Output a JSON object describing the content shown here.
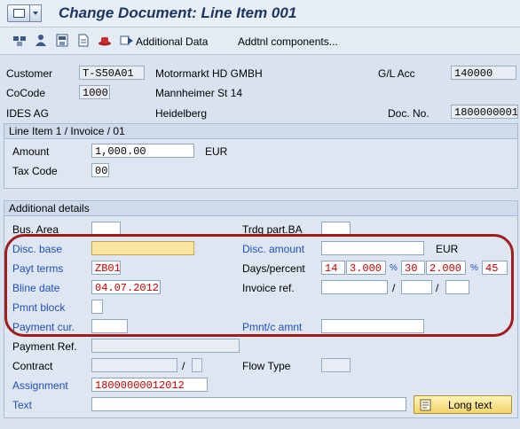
{
  "window": {
    "title": "Change Document: Line Item 001"
  },
  "toolbar": {
    "additional_data": "Additional Data",
    "addtnl_components": "Addtnl components..."
  },
  "header": {
    "customer_label": "Customer",
    "customer_value": "T-S50A01",
    "customer_name": "Motormarkt HD GMBH",
    "gl_acc_label": "G/L Acc",
    "gl_acc_value": "140000",
    "cocode_label": "CoCode",
    "cocode_value": "1000",
    "street": "Mannheimer St 14",
    "company": "IDES AG",
    "city": "Heidelberg",
    "doc_no_label": "Doc. No.",
    "doc_no_value": "1800000001"
  },
  "line_item": {
    "section_title": "Line Item 1 / Invoice / 01",
    "amount_label": "Amount",
    "amount_value": "1,000.00",
    "currency": "EUR",
    "tax_code_label": "Tax Code",
    "tax_code_value": "00"
  },
  "additional": {
    "section_title": "Additional details",
    "bus_area_label": "Bus. Area",
    "bus_area_value": "",
    "trdg_label": "Trdg part.BA",
    "trdg_value": "",
    "disc_base_label": "Disc. base",
    "disc_base_value": "",
    "disc_amount_label": "Disc. amount",
    "disc_amount_value": "",
    "disc_currency": "EUR",
    "payt_terms_label": "Payt terms",
    "payt_terms_value": "ZB01",
    "days_percent_label": "Days/percent",
    "days1": "14",
    "pct1": "3.000",
    "days2": "30",
    "pct2": "2.000",
    "days3": "45",
    "percent_sign": "%",
    "bline_label": "Bline date",
    "bline_value": "04.07.2012",
    "invoice_ref_label": "Invoice ref.",
    "slash": "/",
    "pmnt_block_label": "Pmnt block",
    "payment_cur_label": "Payment cur.",
    "pmnt_c_amnt_label": "Pmnt/c amnt",
    "payment_ref_label": "Payment Ref.",
    "contract_label": "Contract",
    "flow_type_label": "Flow Type",
    "assignment_label": "Assignment",
    "assignment_value": "18000000012012",
    "text_label": "Text",
    "long_text_button": "Long text"
  }
}
